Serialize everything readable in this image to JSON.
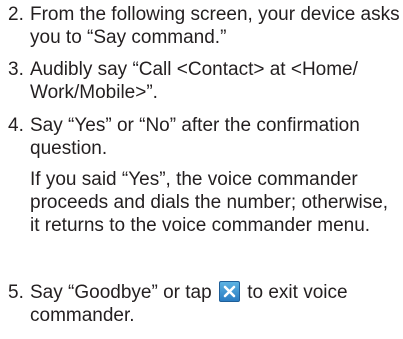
{
  "steps": [
    {
      "number": "2.",
      "text": "From the following screen, your device asks you to “Say command.”"
    },
    {
      "number": "3.",
      "text": "Audibly say “Call <Contact> at <Home/ Work/Mobile>”."
    },
    {
      "number": "4.",
      "text": "Say “Yes” or “No” after the confirmation question."
    },
    {
      "number": "5.",
      "text_before_icon": "Say “Goodbye” or tap",
      "icon": "close-icon",
      "text_after_icon": "to exit voice commander."
    }
  ],
  "note": "If you said “Yes”, the voice commander proceeds and dials the number; otherwise, it returns to the voice commander menu.",
  "colors": {
    "text": "#231f20",
    "icon_blue": "#3a8fd1"
  }
}
